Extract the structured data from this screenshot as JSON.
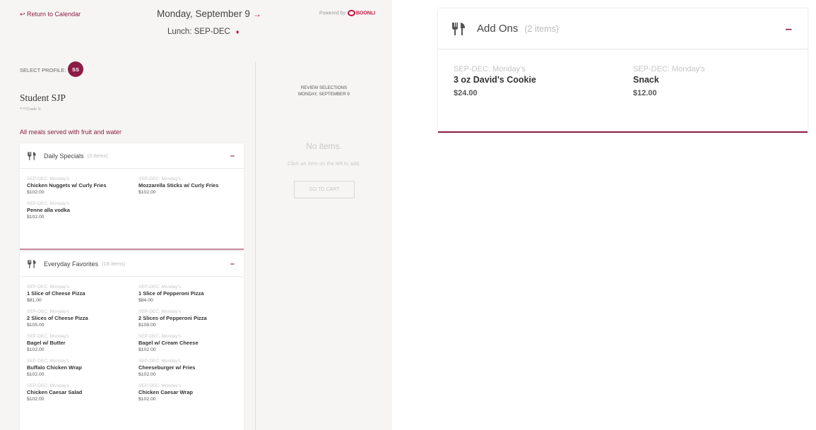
{
  "nav": {
    "return_label": "↩ Return to Calendar",
    "date_label": "Monday, September 9",
    "date_arrow": "→",
    "meal_label": "Lunch: SEP-DEC",
    "meal_arrow": "♦",
    "powered_by": "Powered by",
    "brand": "BOONLI"
  },
  "profile": {
    "select_label": "SELECT PROFILE:",
    "initials": "SS",
    "name": "Student SJP",
    "sub": "*/*/Grade 5/"
  },
  "notice": "All meals served with fruit and water",
  "review": {
    "heading_line1": "REVIEW SELECTIONS",
    "heading_line2": "MONDAY, SEPTEMBER 9",
    "empty_title": "No items.",
    "empty_hint": "Click an item on the left to add.",
    "cart_button": "GO TO CART"
  },
  "daily_specials": {
    "title": "Daily Specials",
    "count": "(3 items)",
    "toggle": "–",
    "items": [
      {
        "cat": "SEP-DEC: Monday's",
        "name": "Chicken Nuggets w/ Curly Fries",
        "price": "$102.00"
      },
      {
        "cat": "SEP-DEC: Monday's",
        "name": "Mozzarella Sticks w/ Curly Fries",
        "price": "$102.00"
      },
      {
        "cat": "SEP-DEC: Monday's",
        "name": "Penne alla vodka",
        "price": "$102.00"
      }
    ]
  },
  "everyday_favorites": {
    "title": "Everyday Favorites",
    "count": "(18 items)",
    "toggle": "–",
    "items": [
      {
        "cat": "SEP-DEC: Monday's",
        "name": "1 Slice of Cheese Pizza",
        "price": "$81.00"
      },
      {
        "cat": "SEP-DEC: Monday's",
        "name": "1 Slice of Pepperoni Pizza",
        "price": "$84.00"
      },
      {
        "cat": "SEP-DEC: Monday's",
        "name": "2 Slices of Cheese Pizza",
        "price": "$105.00"
      },
      {
        "cat": "SEP-DEC: Monday's",
        "name": "2 Slices of Pepperoni Pizza",
        "price": "$108.00"
      },
      {
        "cat": "SEP-DEC: Monday's",
        "name": "Bagel w/ Butter",
        "price": "$102.00"
      },
      {
        "cat": "SEP-DEC: Monday's",
        "name": "Bagel w/ Cream Cheese",
        "price": "$102.00"
      },
      {
        "cat": "SEP-DEC: Monday's",
        "name": "Buffalo Chicken Wrap",
        "price": "$102.00"
      },
      {
        "cat": "SEP-DEC: Monday's",
        "name": "Cheeseburger w/ Fries",
        "price": "$102.00"
      },
      {
        "cat": "SEP-DEC: Monday's",
        "name": "Chicken Caesar Salad",
        "price": "$102.00"
      },
      {
        "cat": "SEP-DEC: Monday's",
        "name": "Chicken Caesar Wrap",
        "price": "$102.00"
      }
    ]
  },
  "add_ons": {
    "title": "Add Ons",
    "count": "(2 items)",
    "toggle": "–",
    "items": [
      {
        "cat": "SEP-DEC: Monday's",
        "name": "3 oz David's Cookie",
        "price": "$24.00"
      },
      {
        "cat": "SEP-DEC: Monday's",
        "name": "Snack",
        "price": "$12.00"
      }
    ]
  },
  "colors": {
    "accent": "#8c1d45",
    "arrow": "#c0143c"
  },
  "icons": {
    "category": "fork-knife-icon",
    "avatar": "avatar"
  }
}
